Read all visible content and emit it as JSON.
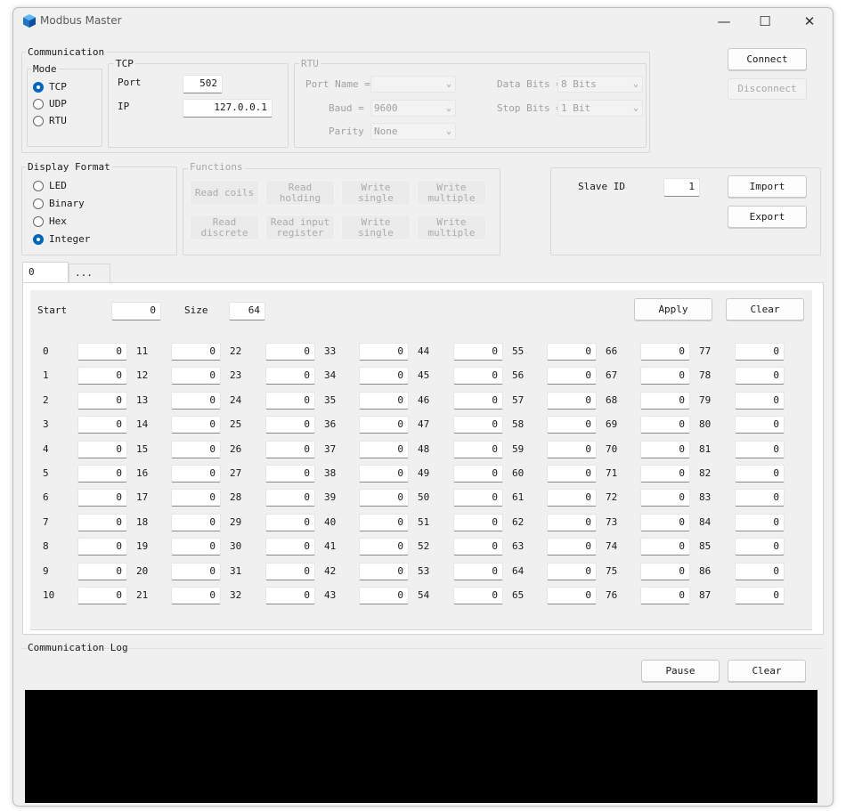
{
  "window": {
    "title": "Modbus Master",
    "controls": {
      "minimize": "—",
      "maximize": "☐",
      "close": "✕"
    }
  },
  "communication": {
    "label": "Communication",
    "mode": {
      "label": "Mode",
      "options": [
        "TCP",
        "UDP",
        "RTU"
      ],
      "selected": "TCP"
    },
    "tcp": {
      "label": "TCP",
      "port_label": "Port",
      "port": "502",
      "ip_label": "IP",
      "ip": "127.0.0.1"
    },
    "rtu": {
      "label": "RTU",
      "port_name_label": "Port Name =",
      "port_name": "",
      "baud_label": "Baud =",
      "baud": "9600",
      "parity_label": "Parity",
      "parity": "None",
      "data_bits_label": "Data Bits =",
      "data_bits": "8 Bits",
      "stop_bits_label": "Stop Bits =",
      "stop_bits": "1 Bit"
    }
  },
  "connect_label": "Connect",
  "disconnect_label": "Disconnect",
  "display_format": {
    "label": "Display Format",
    "options": [
      "LED",
      "Binary",
      "Hex",
      "Integer"
    ],
    "selected": "Integer"
  },
  "functions": {
    "label": "Functions",
    "read_coils": "Read coils",
    "read_holding": [
      "Read",
      "holding"
    ],
    "write_single_1": [
      "Write",
      "single"
    ],
    "write_multiple_1": [
      "Write",
      "multiple"
    ],
    "read_discrete": [
      "Read",
      "discrete"
    ],
    "read_input": [
      "Read input",
      "register"
    ],
    "write_single_2": [
      "Write",
      "single"
    ],
    "write_multiple_2": [
      "Write",
      "multiple"
    ]
  },
  "slave": {
    "label": "Slave ID",
    "value": "1"
  },
  "import_label": "Import",
  "export_label": "Export",
  "tabs": [
    "0",
    "..."
  ],
  "registers": {
    "start_label": "Start",
    "start": "0",
    "size_label": "Size",
    "size": "64",
    "apply_label": "Apply",
    "clear_label": "Clear",
    "rows": 11,
    "columns": 8,
    "addresses": [
      0,
      1,
      2,
      3,
      4,
      5,
      6,
      7,
      8,
      9,
      10,
      11,
      12,
      13,
      14,
      15,
      16,
      17,
      18,
      19,
      20,
      21,
      22,
      23,
      24,
      25,
      26,
      27,
      28,
      29,
      30,
      31,
      32,
      33,
      34,
      35,
      36,
      37,
      38,
      39,
      40,
      41,
      42,
      43,
      44,
      45,
      46,
      47,
      48,
      49,
      50,
      51,
      52,
      53,
      54,
      55,
      56,
      57,
      58,
      59,
      60,
      61,
      62,
      63,
      64,
      65,
      66,
      67,
      68,
      69,
      70,
      71,
      72,
      73,
      74,
      75,
      76,
      77,
      78,
      79,
      80,
      81,
      82,
      83,
      84,
      85,
      86,
      87
    ],
    "values": [
      "0",
      "0",
      "0",
      "0",
      "0",
      "0",
      "0",
      "0",
      "0",
      "0",
      "0",
      "0",
      "0",
      "0",
      "0",
      "0",
      "0",
      "0",
      "0",
      "0",
      "0",
      "0",
      "0",
      "0",
      "0",
      "0",
      "0",
      "0",
      "0",
      "0",
      "0",
      "0",
      "0",
      "0",
      "0",
      "0",
      "0",
      "0",
      "0",
      "0",
      "0",
      "0",
      "0",
      "0",
      "0",
      "0",
      "0",
      "0",
      "0",
      "0",
      "0",
      "0",
      "0",
      "0",
      "0",
      "0",
      "0",
      "0",
      "0",
      "0",
      "0",
      "0",
      "0",
      "0",
      "0",
      "0",
      "0",
      "0",
      "0",
      "0",
      "0",
      "0",
      "0",
      "0",
      "0",
      "0",
      "0",
      "0",
      "0",
      "0",
      "0",
      "0",
      "0",
      "0",
      "0",
      "0",
      "0",
      "0"
    ]
  },
  "log": {
    "label": "Communication Log",
    "pause_label": "Pause",
    "clear_label": "Clear"
  },
  "colors": {
    "accent": "#0067c0",
    "log_background": "#000000"
  }
}
